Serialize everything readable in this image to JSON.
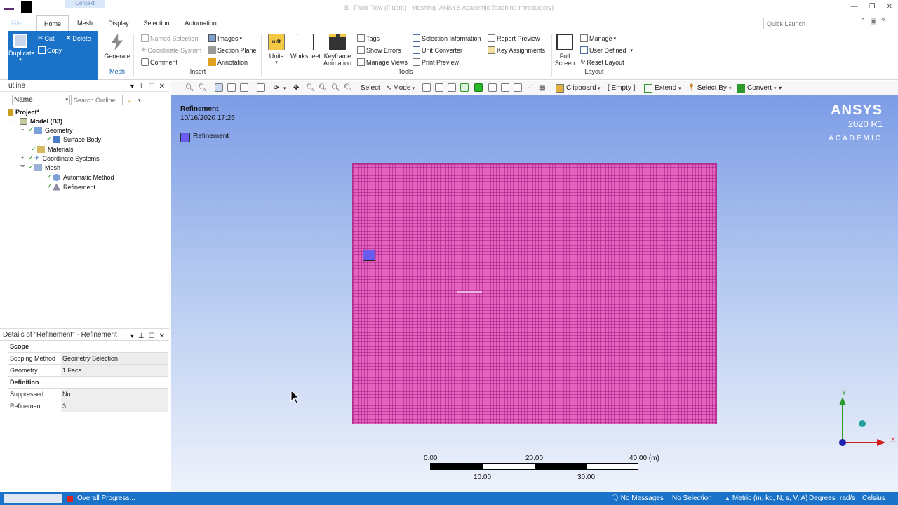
{
  "window": {
    "context_label": "Context",
    "title": "B : Fluid Flow (Fluent) - Meshing [ANSYS Academic Teaching Introductory]"
  },
  "tabs": {
    "file": "File",
    "items": [
      "Home",
      "Mesh",
      "Display",
      "Selection",
      "Automation"
    ],
    "active": "Home",
    "quick_launch_placeholder": "Quick Launch"
  },
  "ribbon": {
    "clipboard": {
      "duplicate": "Duplicate",
      "cut": "Cut",
      "copy": "Copy",
      "delete": "Delete"
    },
    "mesh_group": {
      "generate": "Generate",
      "label": "Mesh"
    },
    "insert_group": {
      "named_selection": "Named Selection",
      "coordinate_system": "Coordinate System",
      "comment": "Comment",
      "images": "Images",
      "section_plane": "Section Plane",
      "annotation": "Annotation",
      "label": "Insert"
    },
    "tools_group": {
      "units": "Units",
      "worksheet": "Worksheet",
      "keyframe_1": "Keyframe",
      "keyframe_2": "Animation",
      "tags": "Tags",
      "show_errors": "Show Errors",
      "manage_views": "Manage Views",
      "selection_information": "Selection Information",
      "unit_converter": "Unit Converter",
      "print_preview": "Print Preview",
      "report_preview": "Report Preview",
      "key_assignments": "Key Assignments",
      "label": "Tools"
    },
    "layout_group": {
      "full_1": "Full",
      "full_2": "Screen",
      "manage": "Manage",
      "user_defined": "User Defined",
      "reset_layout": "Reset Layout",
      "label": "Layout"
    }
  },
  "toolbar": {
    "select": "Select",
    "mode": "Mode",
    "clipboard": "Clipboard",
    "empty": "[ Empty ]",
    "extend": "Extend",
    "select_by": "Select By",
    "convert": "Convert"
  },
  "outline": {
    "title": "utline",
    "filter": "Name",
    "search_placeholder": "Search Outline",
    "tree": {
      "project": "Project*",
      "model": "Model (B3)",
      "geometry": "Geometry",
      "surface_body": "Surface Body",
      "materials": "Materials",
      "coordinate_systems": "Coordinate Systems",
      "mesh": "Mesh",
      "automatic_method": "Automatic Method",
      "refinement": "Refinement"
    }
  },
  "details": {
    "title": "Details of \"Refinement\" - Refinement",
    "scope": "Scope",
    "scoping_method_key": "Scoping Method",
    "scoping_method_val": "Geometry Selection",
    "geometry_key": "Geometry",
    "geometry_val": "1 Face",
    "definition": "Definition",
    "suppressed_key": "Suppressed",
    "suppressed_val": "No",
    "refinement_key": "Refinement",
    "refinement_val": "3"
  },
  "viewport": {
    "title": "Refinement",
    "date": "10/16/2020 17:26",
    "legend": "Refinement",
    "logo": "ANSYS",
    "version": "2020 R1",
    "edition": "ACADEMIC",
    "scale_labels": {
      "s0": "0.00",
      "s10": "10.00",
      "s20": "20.00",
      "s30": "30.00",
      "s40": "40.00 (m)"
    },
    "axis_x": "X",
    "axis_y": "Y",
    "colors": {
      "mesh": "#e763c0",
      "selection": "#6a5cf0"
    }
  },
  "status": {
    "overall": "Overall Progress...",
    "messages": "No Messages",
    "selection": "No Selection",
    "units": "Metric (m, kg, N, s, V, A)",
    "angle": "Degrees",
    "rate": "rad/s",
    "temp": "Celsius"
  }
}
